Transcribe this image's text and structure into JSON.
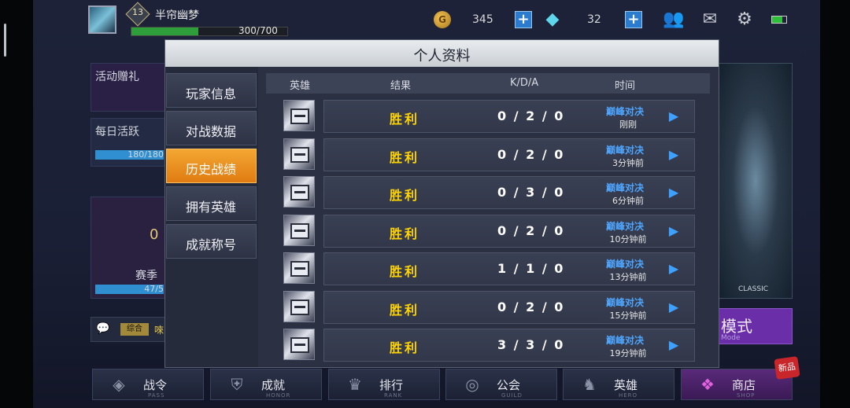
{
  "topbar": {
    "level": "13",
    "player_name": "半帘幽梦",
    "xp_text": "300/700",
    "xp_fraction": 0.43,
    "coin_symbol": "G",
    "coins": "345",
    "gems": "32"
  },
  "background": {
    "event_gift": "活动赠礼",
    "daily_active": "每日活跃",
    "daily_progress": "180/180",
    "season_level": "0",
    "season_label": "赛季",
    "season_progress": "47/5",
    "chat_tag": "综合",
    "chat_preview": "唻",
    "mode_label": "模式",
    "mode_sub": "Mode",
    "classic_label": "CLASSIC"
  },
  "modal": {
    "title": "个人资料",
    "tabs": [
      {
        "label": "玩家信息"
      },
      {
        "label": "对战数据"
      },
      {
        "label": "历史战绩"
      },
      {
        "label": "拥有英雄"
      },
      {
        "label": "成就称号"
      }
    ],
    "active_tab": 2,
    "columns": {
      "hero": "英雄",
      "result": "结果",
      "kda": "K/D/A",
      "time": "时间"
    },
    "rows": [
      {
        "result": "胜利",
        "kda": "0 / 2 / 0",
        "mode": "巅峰对决",
        "time": "刚刚"
      },
      {
        "result": "胜利",
        "kda": "0 / 2 / 0",
        "mode": "巅峰对决",
        "time": "3分钟前"
      },
      {
        "result": "胜利",
        "kda": "0 / 3 / 0",
        "mode": "巅峰对决",
        "time": "6分钟前"
      },
      {
        "result": "胜利",
        "kda": "0 / 2 / 0",
        "mode": "巅峰对决",
        "time": "10分钟前"
      },
      {
        "result": "胜利",
        "kda": "1 / 1 / 0",
        "mode": "巅峰对决",
        "time": "13分钟前"
      },
      {
        "result": "胜利",
        "kda": "0 / 2 / 0",
        "mode": "巅峰对决",
        "time": "15分钟前"
      },
      {
        "result": "胜利",
        "kda": "3 / 3 / 0",
        "mode": "巅峰对决",
        "time": "19分钟前"
      }
    ]
  },
  "bottom_nav": [
    {
      "label": "战令",
      "sub": "PASS"
    },
    {
      "label": "成就",
      "sub": "HONOR"
    },
    {
      "label": "排行",
      "sub": "RANK"
    },
    {
      "label": "公会",
      "sub": "GUILD"
    },
    {
      "label": "英雄",
      "sub": "HERO"
    },
    {
      "label": "商店",
      "sub": "SHOP"
    }
  ],
  "new_badge": "新品",
  "colors": {
    "accent_orange": "#e07b12",
    "win_yellow": "#ffd400",
    "mode_blue": "#4ea6ff"
  }
}
